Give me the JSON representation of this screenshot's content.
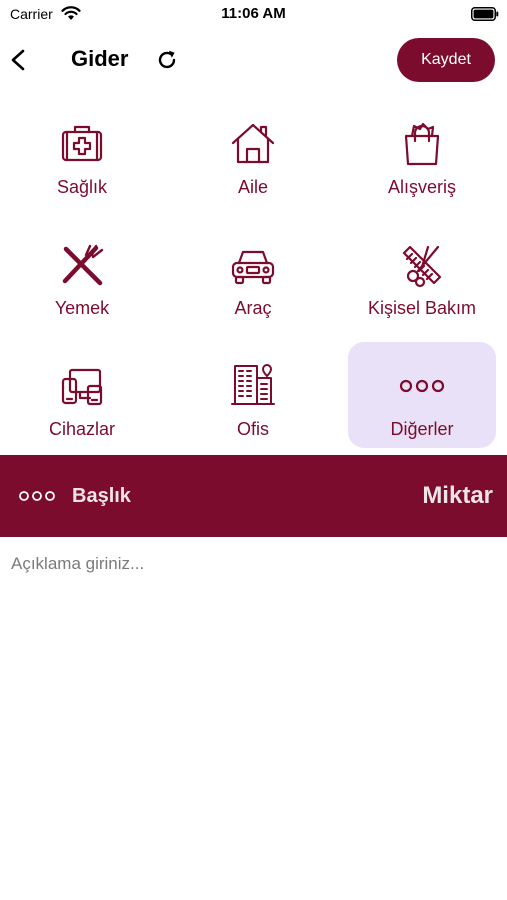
{
  "status_bar": {
    "carrier": "Carrier",
    "time": "11:06 AM",
    "wifi_icon": "wifi-icon",
    "battery_icon": "battery-icon"
  },
  "nav": {
    "back_icon": "chevron-left-icon",
    "title": "Gider",
    "refresh_icon": "refresh-icon",
    "save_label": "Kaydet"
  },
  "categories": [
    {
      "label": "Sağlık",
      "icon": "first-aid-kit-icon",
      "selected": false
    },
    {
      "label": "Aile",
      "icon": "house-icon",
      "selected": false
    },
    {
      "label": "Alışveriş",
      "icon": "shopping-bag-icon",
      "selected": false
    },
    {
      "label": "Yemek",
      "icon": "fork-knife-icon",
      "selected": false
    },
    {
      "label": "Araç",
      "icon": "car-icon",
      "selected": false
    },
    {
      "label": "Kişisel Bakım",
      "icon": "comb-scissors-icon",
      "selected": false
    },
    {
      "label": "Cihazlar",
      "icon": "devices-icon",
      "selected": false
    },
    {
      "label": "Ofis",
      "icon": "office-building-icon",
      "selected": false
    },
    {
      "label": "Diğerler",
      "icon": "more-dots-icon",
      "selected": true
    }
  ],
  "entry": {
    "category_icon": "more-dots-icon",
    "title_placeholder": "Başlık",
    "title_value": "",
    "amount_placeholder": "Miktar",
    "amount_value": "",
    "description_placeholder": "Açıklama giriniz...",
    "description_value": ""
  },
  "colors": {
    "accent": "#7b0c2e",
    "selected_background": "#e9e1f7",
    "background": "#ffffff"
  }
}
